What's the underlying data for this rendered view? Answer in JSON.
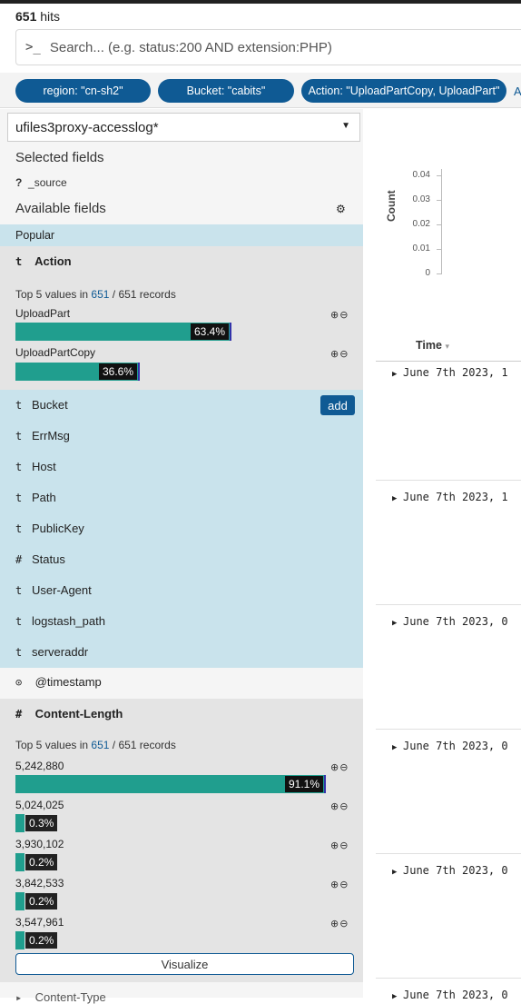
{
  "hits": {
    "count": "651",
    "label": "hits"
  },
  "search": {
    "prompt": ">_",
    "placeholder": "Search... (e.g. status:200 AND extension:PHP)"
  },
  "filters": [
    "region: \"cn-sh2\"",
    "Bucket: \"cabits\"",
    "Action: \"UploadPartCopy, UploadPart\"",
    "A"
  ],
  "sidebar": {
    "index_pattern": "ufiles3proxy-accesslog*",
    "selected_fields_label": "Selected fields",
    "source_field": {
      "type": "?",
      "name": "_source"
    },
    "available_fields_label": "Available fields",
    "popular_label": "Popular",
    "action_field": {
      "type": "t",
      "name": "Action",
      "summary_prefix": "Top 5 values in",
      "summary_count": "651",
      "summary_suffix": "/ 651 records",
      "values": [
        {
          "label": "UploadPart",
          "pct": "63.4%",
          "fraction": 0.634
        },
        {
          "label": "UploadPartCopy",
          "pct": "36.6%",
          "fraction": 0.366
        }
      ]
    },
    "popular_fields": [
      {
        "type": "t",
        "name": "Bucket"
      },
      {
        "type": "t",
        "name": "ErrMsg"
      },
      {
        "type": "t",
        "name": "Host"
      },
      {
        "type": "t",
        "name": "Path"
      },
      {
        "type": "t",
        "name": "PublicKey"
      },
      {
        "type": "#",
        "name": "Status"
      },
      {
        "type": "t",
        "name": "User-Agent"
      },
      {
        "type": "t",
        "name": "logstash_path"
      },
      {
        "type": "t",
        "name": "serveraddr"
      }
    ],
    "add_label": "add",
    "timestamp_field": {
      "type": "⊙",
      "name": "@timestamp"
    },
    "content_length_field": {
      "type": "#",
      "name": "Content-Length",
      "summary_prefix": "Top 5 values in",
      "summary_count": "651",
      "summary_suffix": "/ 651 records",
      "values": [
        {
          "label": "5,242,880",
          "pct": "91.1%",
          "fraction": 0.911
        },
        {
          "label": "5,024,025",
          "pct": "0.3%",
          "fraction": 0.003
        },
        {
          "label": "3,930,102",
          "pct": "0.2%",
          "fraction": 0.002
        },
        {
          "label": "3,842,533",
          "pct": "0.2%",
          "fraction": 0.002
        },
        {
          "label": "3,547,961",
          "pct": "0.2%",
          "fraction": 0.002
        }
      ]
    },
    "visualize_label": "Visualize",
    "next_field": {
      "type": "▸",
      "name": "Content-Type"
    }
  },
  "histogram": {
    "ylabel": "Count",
    "yticks": [
      "0.04",
      "0.03",
      "0.02",
      "0.01",
      "0"
    ]
  },
  "table": {
    "time_header": "Time",
    "rows": [
      "June 7th 2023, 1",
      "June 7th 2023, 1",
      "June 7th 2023, 0",
      "June 7th 2023, 0",
      "June 7th 2023, 0",
      "June 7th 2023, 0"
    ]
  }
}
